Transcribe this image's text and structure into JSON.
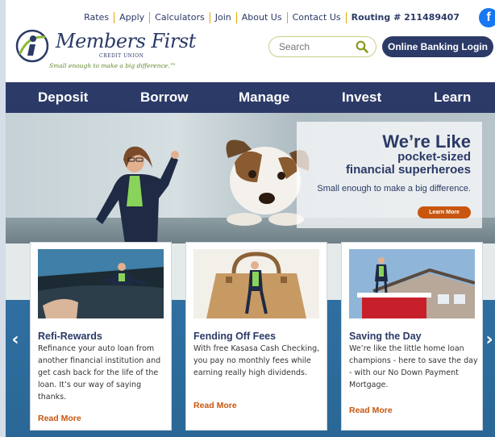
{
  "utility_nav": {
    "items": [
      "Rates",
      "Apply",
      "Calculators",
      "Join",
      "About Us",
      "Contact Us"
    ],
    "routing": "Routing # 211489407",
    "facebook": "f"
  },
  "logo": {
    "name": "Members First",
    "subname": "CREDIT UNION",
    "tagline": "Small enough to make a big difference.™"
  },
  "search": {
    "placeholder": "Search"
  },
  "login": {
    "label": "Online Banking Login"
  },
  "main_nav": {
    "items": [
      "Deposit",
      "Borrow",
      "Manage",
      "Invest",
      "Learn"
    ]
  },
  "hero": {
    "headline": "We’re Like",
    "subheadline_line1": "pocket-sized",
    "subheadline_line2": "financial superheroes",
    "tagline": "Small enough to make a big difference.",
    "button": "Learn More"
  },
  "cards": [
    {
      "title": "Refi-Rewards",
      "text": "Refinance your auto loan from another financial institution and get cash back for the life of the loan. It’s our way of saying thanks.",
      "link": "Read More"
    },
    {
      "title": "Fending Off Fees",
      "text": "With free Kasasa Cash Checking, you pay no monthly fees while earning really high dividends.",
      "link": "Read More"
    },
    {
      "title": "Saving the Day",
      "text": "We’re like the little home loan champions - here to save the day - with our No Down Payment Mortgage.",
      "link": "Read More"
    }
  ],
  "carousel": {
    "prev": "‹",
    "next": "›"
  },
  "colors": {
    "navy": "#2b3a67",
    "orange": "#c8560e",
    "gold": "#e0a800",
    "green": "#5f8a2e"
  }
}
